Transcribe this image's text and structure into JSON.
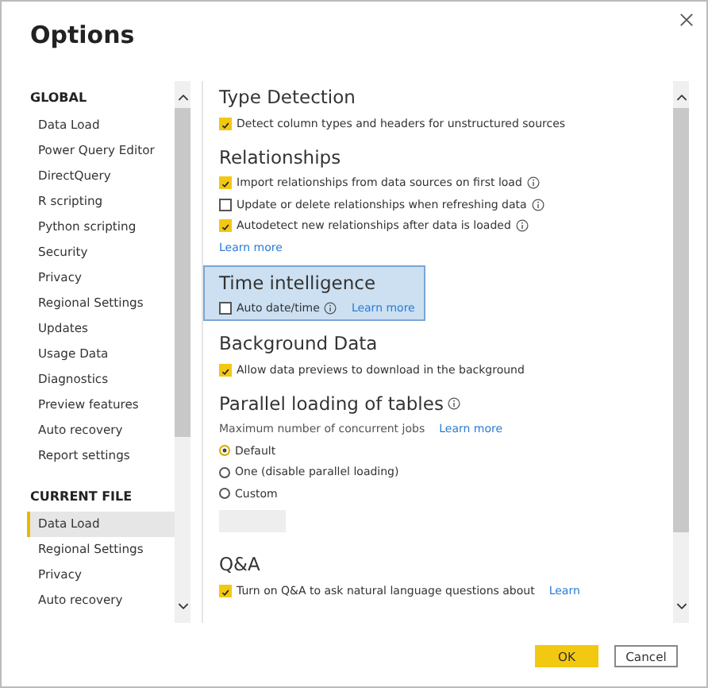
{
  "window": {
    "title": "Options"
  },
  "nav": [
    {
      "heading": "GLOBAL",
      "items": [
        {
          "label": "Data Load",
          "selected": false
        },
        {
          "label": "Power Query Editor",
          "selected": false
        },
        {
          "label": "DirectQuery",
          "selected": false
        },
        {
          "label": "R scripting",
          "selected": false
        },
        {
          "label": "Python scripting",
          "selected": false
        },
        {
          "label": "Security",
          "selected": false
        },
        {
          "label": "Privacy",
          "selected": false
        },
        {
          "label": "Regional Settings",
          "selected": false
        },
        {
          "label": "Updates",
          "selected": false
        },
        {
          "label": "Usage Data",
          "selected": false
        },
        {
          "label": "Diagnostics",
          "selected": false
        },
        {
          "label": "Preview features",
          "selected": false
        },
        {
          "label": "Auto recovery",
          "selected": false
        },
        {
          "label": "Report settings",
          "selected": false
        }
      ]
    },
    {
      "heading": "CURRENT FILE",
      "items": [
        {
          "label": "Data Load",
          "selected": true
        },
        {
          "label": "Regional Settings",
          "selected": false
        },
        {
          "label": "Privacy",
          "selected": false
        },
        {
          "label": "Auto recovery",
          "selected": false
        }
      ]
    }
  ],
  "sections": [
    {
      "title": "Type Detection",
      "info": false,
      "highlighted": false,
      "items": [
        {
          "kind": "checkbox",
          "label": "Detect column types and headers for unstructured sources",
          "checked": true,
          "info": false
        }
      ]
    },
    {
      "title": "Relationships",
      "info": false,
      "highlighted": false,
      "items": [
        {
          "kind": "checkbox",
          "label": "Import relationships from data sources on first load",
          "checked": true,
          "info": true
        },
        {
          "kind": "checkbox",
          "label": "Update or delete relationships when refreshing data",
          "checked": false,
          "info": true
        },
        {
          "kind": "checkbox",
          "label": "Autodetect new relationships after data is loaded",
          "checked": true,
          "info": true
        },
        {
          "kind": "link",
          "label": "Learn more"
        }
      ]
    },
    {
      "title": "Time intelligence",
      "info": false,
      "highlighted": true,
      "items": [
        {
          "kind": "checkbox",
          "label": "Auto date/time",
          "checked": false,
          "info": true,
          "link": "Learn more"
        }
      ]
    },
    {
      "title": "Background Data",
      "info": false,
      "highlighted": false,
      "items": [
        {
          "kind": "checkbox",
          "label": "Allow data previews to download in the background",
          "checked": true,
          "info": false
        }
      ]
    },
    {
      "title": "Parallel loading of tables",
      "info": true,
      "highlighted": false,
      "items": [
        {
          "kind": "text",
          "label": "Maximum number of concurrent jobs",
          "link": "Learn more"
        },
        {
          "kind": "radio",
          "label": "Default",
          "selected": true
        },
        {
          "kind": "radio",
          "label": "One (disable parallel loading)",
          "selected": false
        },
        {
          "kind": "radio",
          "label": "Custom",
          "selected": false
        },
        {
          "kind": "input"
        }
      ]
    },
    {
      "title": "Q&A",
      "info": false,
      "highlighted": false,
      "items": [
        {
          "kind": "checkbox",
          "label": "Turn on Q&A to ask natural language questions about",
          "checked": true,
          "info": false,
          "link": "Learn"
        }
      ]
    }
  ],
  "buttons": [
    {
      "label": "OK",
      "primary": true
    },
    {
      "label": "Cancel",
      "primary": false
    }
  ]
}
